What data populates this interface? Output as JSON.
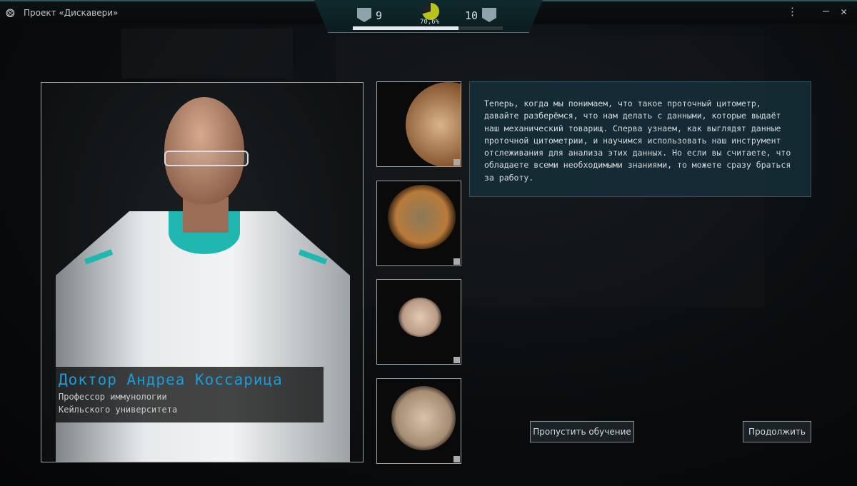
{
  "window": {
    "title": "Проект «Дискавери»",
    "icons": {
      "app": "project-discovery-icon",
      "menu": "more-vertical-icon",
      "minimize": "minimize-icon",
      "close": "close-icon"
    }
  },
  "hud": {
    "rank_left": "9",
    "rank_right": "10",
    "progress_label": "70,6%",
    "progress_percent": 70.6,
    "gauge_color": "#b8c21a"
  },
  "character": {
    "name": "Доктор Андреа Коссарица",
    "title_line1": "Профессор иммунологии",
    "title_line2": "Кейльского университета",
    "name_color": "#1d9bd6"
  },
  "tutorial": {
    "text": "Теперь, когда мы понимаем, что такое проточный цитометр, давайте разберёмся, что нам делать с данными, которые выдаёт наш механический товарищ. Сперва узнаем, как выглядят данные проточной цитометрии, и научимся использовать наш инструмент отслеживания для анализа этих данных. Но если вы считаете, что обладаете всеми необходимыми знаниями, то можете сразу браться за работу."
  },
  "buttons": {
    "skip": "Пропустить обучение",
    "continue": "Продолжить"
  }
}
